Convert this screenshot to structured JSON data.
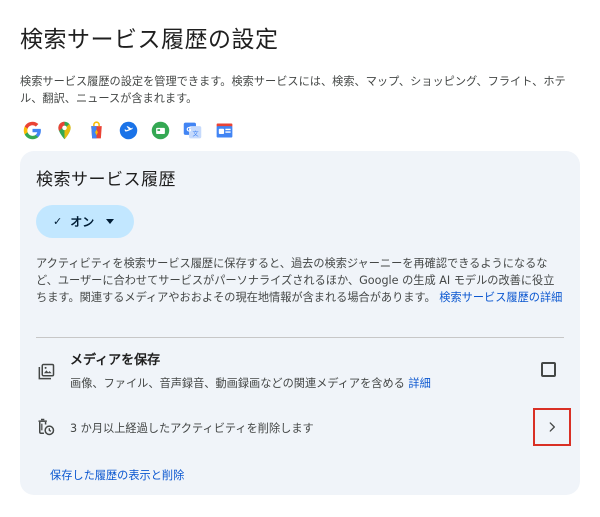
{
  "page": {
    "title": "検索サービス履歴の設定",
    "description": "検索サービス履歴の設定を管理できます。検索サービスには、検索、マップ、ショッピング、フライト、ホテル、翻訳、ニュースが含まれます。"
  },
  "product_icons": [
    {
      "name": "google-icon"
    },
    {
      "name": "maps-icon"
    },
    {
      "name": "shopping-icon"
    },
    {
      "name": "flights-icon"
    },
    {
      "name": "hotels-icon"
    },
    {
      "name": "translate-icon"
    },
    {
      "name": "news-icon"
    }
  ],
  "card": {
    "title": "検索サービス履歴",
    "status_check": "✓",
    "status_label": "オン",
    "description": "アクティビティを検索サービス履歴に保存すると、過去の検索ジャーニーを再確認できるようになるなど、ユーザーに合わせてサービスがパーソナライズされるほか、Google の生成 AI モデルの改善に役立ちます。関連するメディアやおおよその現在地情報が含まれる場合があります。",
    "description_link": "検索サービス履歴の詳細",
    "media": {
      "title": "メディアを保存",
      "description": "画像、ファイル、音声録音、動画録画などの関連メディアを含める",
      "link": "詳細",
      "checked": false
    },
    "auto_delete": {
      "label": "3 か月以上経過したアクティビティを削除します"
    },
    "view_link": "保存した履歴の表示と削除"
  },
  "colors": {
    "accent": "#0b57d0",
    "chip_bg": "#c2e7ff",
    "card_bg": "#f0f4f9",
    "highlight": "#d93025"
  }
}
